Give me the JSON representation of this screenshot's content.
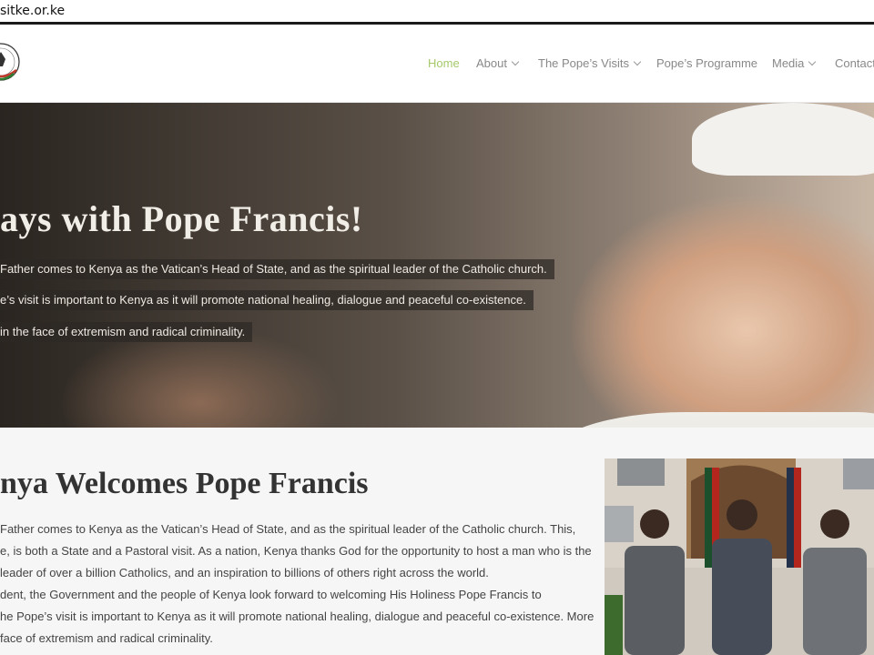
{
  "browser": {
    "url_fragment": "sitke.or.ke"
  },
  "nav": {
    "items": [
      {
        "label": "Home",
        "active": true,
        "has_dropdown": false
      },
      {
        "label": "About",
        "active": false,
        "has_dropdown": true
      },
      {
        "label": "The Pope’s Visits",
        "active": false,
        "has_dropdown": true
      },
      {
        "label": "Pope’s Programme",
        "active": false,
        "has_dropdown": false
      },
      {
        "label": "Media",
        "active": false,
        "has_dropdown": true
      },
      {
        "label": "Contact",
        "active": false,
        "has_dropdown": false
      }
    ],
    "active_color": "#a5c96a",
    "text_color": "#888888"
  },
  "hero": {
    "title": "ays with Pope Francis!",
    "lines": [
      "Father comes to Kenya as the Vatican’s Head of State, and as the spiritual leader of the Catholic church.",
      "e’s visit is important to Kenya as it will promote national healing, dialogue and peaceful co-existence.",
      "in the face of extremism and radical criminality."
    ]
  },
  "main": {
    "title": "nya Welcomes Pope Francis",
    "paragraph_lines": [
      "Father comes to Kenya as the Vatican’s Head of State, and as the spiritual leader of the Catholic church. This,",
      "e, is both a State and a Pastoral visit. As a nation, Kenya thanks God for the opportunity to host a man who is the",
      "leader of over a billion Catholics, and an inspiration to billions of others right across the world.",
      "dent, the Government and the people of Kenya look forward to welcoming His Holiness Pope Francis to",
      "he Pope’s visit is important to Kenya as it will promote national healing, dialogue and peaceful co-existence. More",
      "face of extremism and radical criminality."
    ]
  },
  "colors": {
    "background": "#f6f6f6",
    "accent": "#a5c96a"
  }
}
